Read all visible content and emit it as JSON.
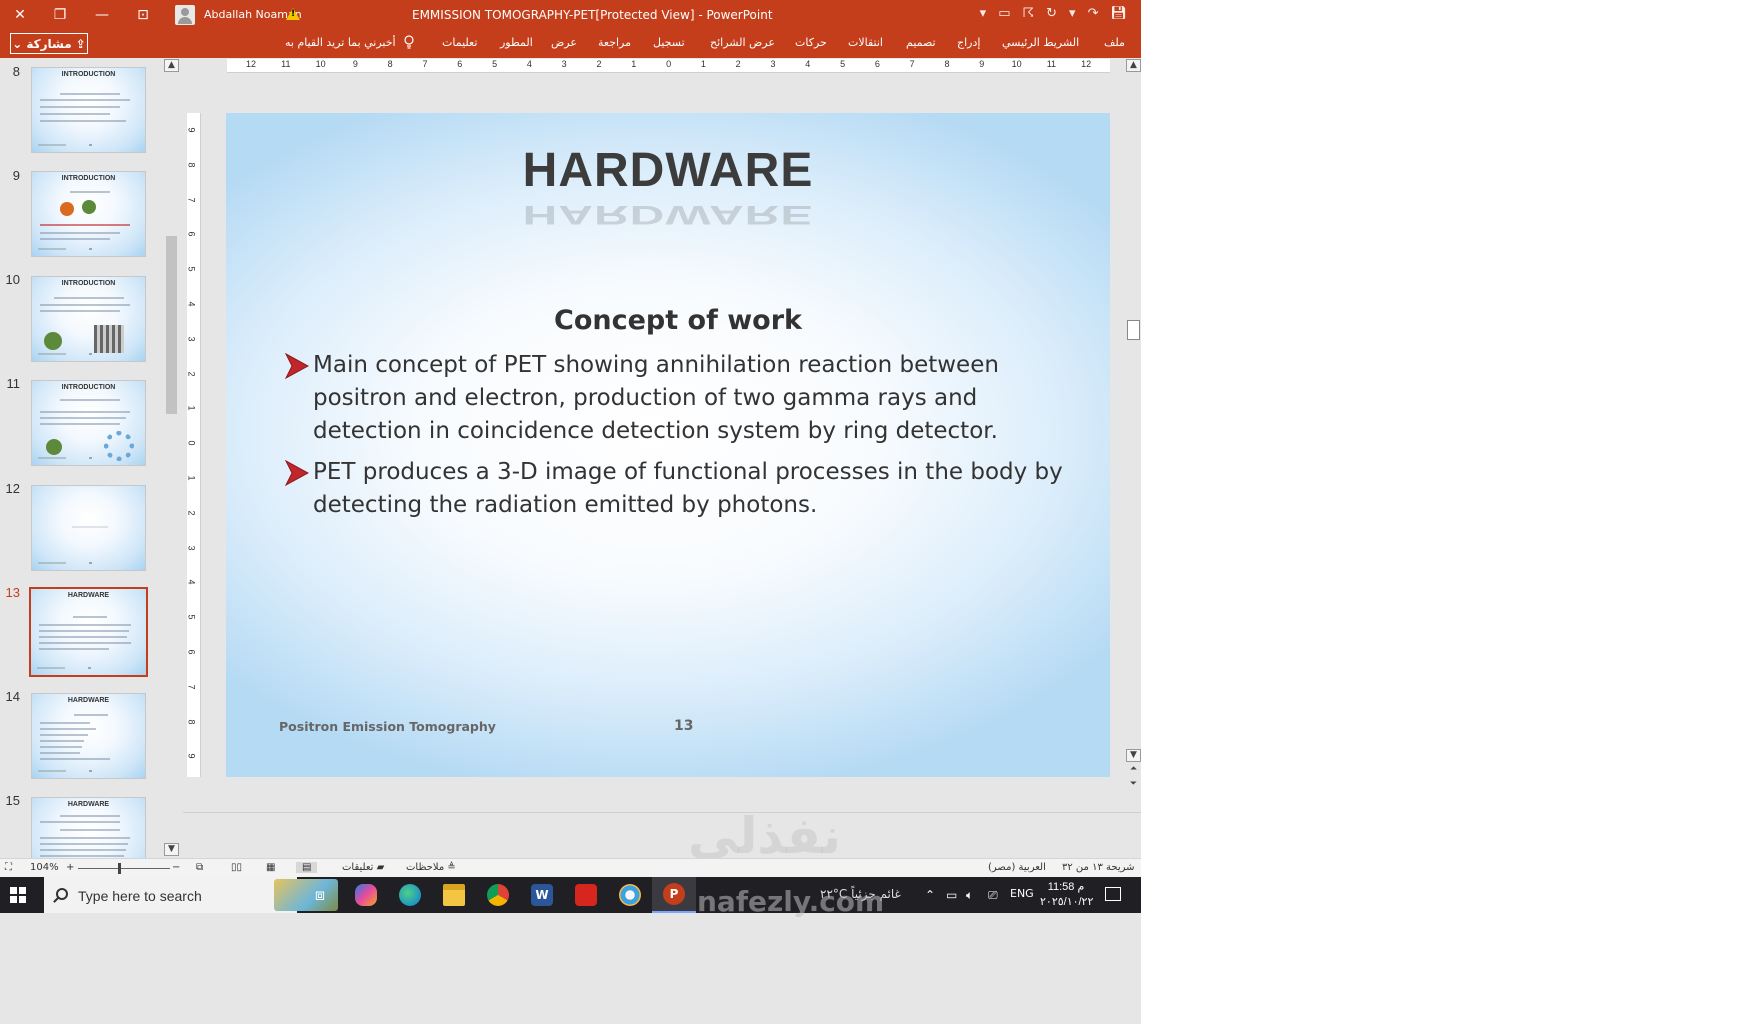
{
  "titlebar": {
    "user_name": "Abdallah Noaman",
    "doc_title": "EMMISSION TOMOGRAPHY-PET[Protected View]  -  PowerPoint",
    "close_glyph": "✕",
    "restore_glyph": "❐",
    "minimize_glyph": "—",
    "ribbon_display_glyph": "⊡"
  },
  "ribbon": {
    "share_label": "مشاركة",
    "tell_me": "أخبرني بما تريد القيام به",
    "tabs": [
      "ملف",
      "الشريط الرئيسي",
      "إدراج",
      "تصميم",
      "انتقالات",
      "حركات",
      "عرض الشرائح",
      "تسجيل",
      "مراجعة",
      "عرض",
      "المطور",
      "تعليمات"
    ]
  },
  "thumbnails": [
    {
      "num": "8",
      "title": "INTRODUCTION"
    },
    {
      "num": "9",
      "title": "INTRODUCTION"
    },
    {
      "num": "10",
      "title": "INTRODUCTION"
    },
    {
      "num": "11",
      "title": "INTRODUCTION"
    },
    {
      "num": "12",
      "title": ""
    },
    {
      "num": "13",
      "title": "HARDWARE"
    },
    {
      "num": "14",
      "title": "HARDWARE"
    },
    {
      "num": "15",
      "title": "HARDWARE"
    }
  ],
  "selected_slide": "13",
  "ruler": {
    "h_labels": [
      "12",
      "11",
      "10",
      "9",
      "8",
      "7",
      "6",
      "5",
      "4",
      "3",
      "2",
      "1",
      "0",
      "1",
      "2",
      "3",
      "4",
      "5",
      "6",
      "7",
      "8",
      "9",
      "10",
      "11",
      "12"
    ],
    "v_labels": [
      "9",
      "8",
      "7",
      "6",
      "5",
      "4",
      "3",
      "2",
      "1",
      "0",
      "1",
      "2",
      "3",
      "4",
      "5",
      "6",
      "7",
      "8",
      "9"
    ]
  },
  "slide": {
    "title": "HARDWARE",
    "subtitle": "Concept of work",
    "bullets": [
      "Main concept of PET showing annihilation reaction between positron and electron, production of two gamma rays and detection in coincidence detection system by ring detector.",
      "PET produces a 3-D image of functional processes in the body by detecting the radiation emitted by photons."
    ],
    "footer": "Positron Emission Tomography",
    "footer_number": "13",
    "accent_arrow_color": "#c0272d"
  },
  "statusbar": {
    "slide_counter": "شريحة ١٣ من ٣٢",
    "language": "العربية (مصر)",
    "notes_label": "ملاحظات",
    "comments_label": "تعليقات",
    "zoom": "104%"
  },
  "taskbar": {
    "search_placeholder": "Type here to search",
    "weather": "٢٢°C غائم جزئياً",
    "lang": "ENG",
    "time": "11:58 م",
    "date": "٢٠٢٥/١٠/٢٢"
  },
  "watermark": {
    "arabic": "نفذلي",
    "latin": "nafezly.com"
  }
}
